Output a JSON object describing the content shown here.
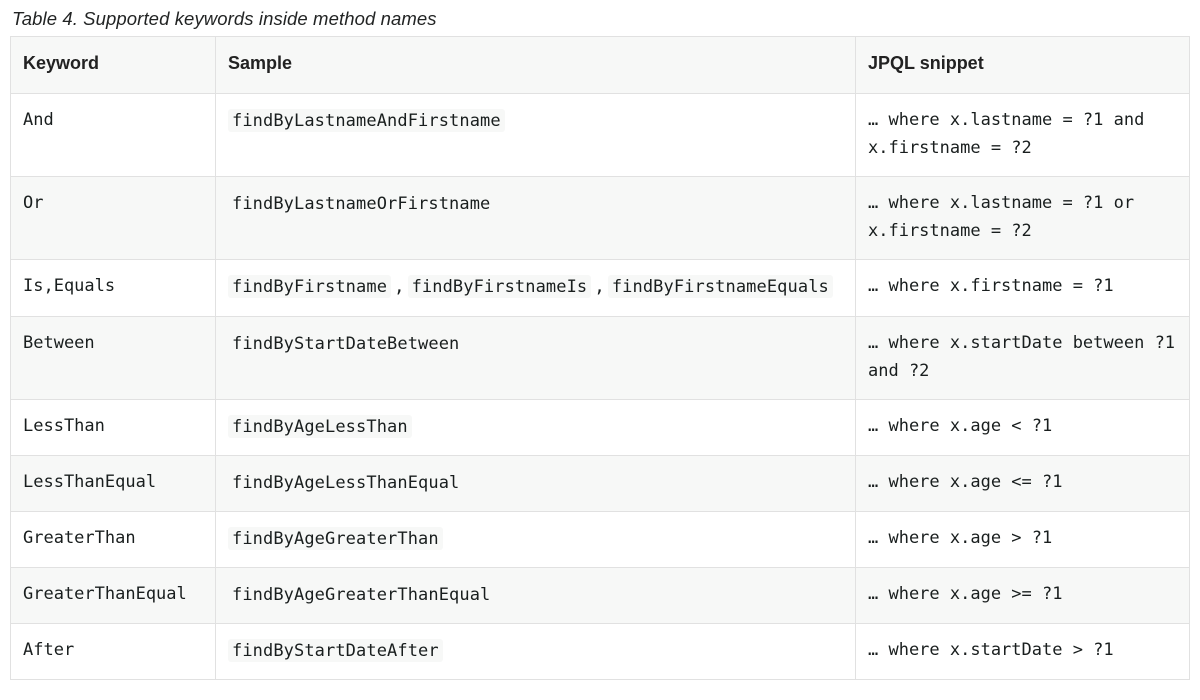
{
  "table": {
    "caption": "Table 4. Supported keywords inside method names",
    "headers": {
      "keyword": "Keyword",
      "sample": "Sample",
      "jpql": "JPQL snippet"
    },
    "rows": [
      {
        "keyword": "And",
        "samples": [
          "findByLastnameAndFirstname"
        ],
        "jpql": "… where x.lastname = ?1 and x.firstname = ?2"
      },
      {
        "keyword": "Or",
        "samples": [
          "findByLastnameOrFirstname"
        ],
        "jpql": "… where x.lastname = ?1 or x.firstname = ?2"
      },
      {
        "keyword": "Is,Equals",
        "samples": [
          "findByFirstname",
          "findByFirstnameIs",
          "findByFirstnameEquals"
        ],
        "jpql": "… where x.firstname = ?1"
      },
      {
        "keyword": "Between",
        "samples": [
          "findByStartDateBetween"
        ],
        "jpql": "… where x.startDate between ?1 and ?2"
      },
      {
        "keyword": "LessThan",
        "samples": [
          "findByAgeLessThan"
        ],
        "jpql": "… where x.age < ?1"
      },
      {
        "keyword": "LessThanEqual",
        "samples": [
          "findByAgeLessThanEqual"
        ],
        "jpql": "… where x.age <= ?1"
      },
      {
        "keyword": "GreaterThan",
        "samples": [
          "findByAgeGreaterThan"
        ],
        "jpql": "… where x.age > ?1"
      },
      {
        "keyword": "GreaterThanEqual",
        "samples": [
          "findByAgeGreaterThanEqual"
        ],
        "jpql": "… where x.age >= ?1"
      },
      {
        "keyword": "After",
        "samples": [
          "findByStartDateAfter"
        ],
        "jpql": "… where x.startDate > ?1"
      }
    ]
  },
  "sample_separator": ","
}
